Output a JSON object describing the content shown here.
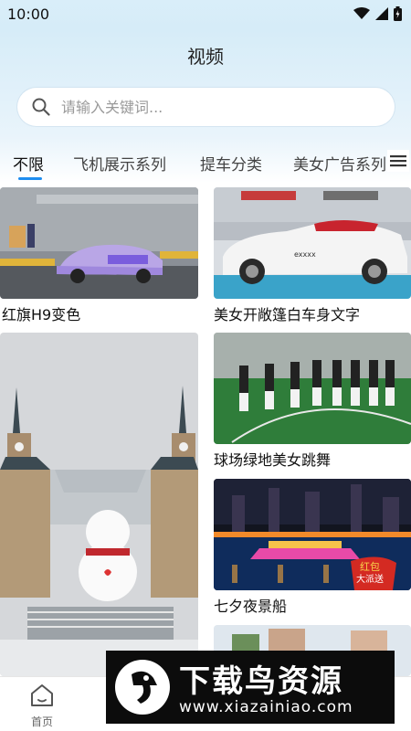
{
  "status_bar": {
    "time": "10:00"
  },
  "header": {
    "title": "视频"
  },
  "search": {
    "placeholder": "请输入关键词..."
  },
  "tabs": [
    {
      "label": "不限",
      "active": true
    },
    {
      "label": "飞机展示系列",
      "active": false
    },
    {
      "label": "提车分类",
      "active": false
    },
    {
      "label": "美女广告系列",
      "active": false
    }
  ],
  "videos": [
    {
      "caption": "红旗H9变色"
    },
    {
      "caption": "美女开敞篷白车身文字"
    },
    {
      "caption": "球场绿地美女跳舞"
    },
    {
      "caption": "七夕夜景船"
    }
  ],
  "thumb_text": {
    "car_plate": "exxxx",
    "redpacket_line1": "红包",
    "redpacket_line2": "大派送"
  },
  "bottom_nav": {
    "home_label": "首页"
  },
  "watermark": {
    "title": "下载鸟资源",
    "url": "www.xiazainiao.com"
  },
  "colors": {
    "accent": "#1d8df0",
    "header_bg": "#d6ecf8"
  }
}
